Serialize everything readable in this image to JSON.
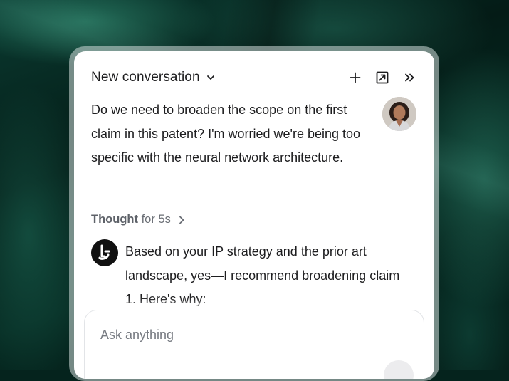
{
  "header": {
    "title": "New conversation",
    "icons": [
      "chevron-down-icon",
      "plus-icon",
      "open-external-icon",
      "double-chevron-right-icon"
    ]
  },
  "conversation": {
    "user_message": "Do we need to broaden the scope on the first claim in this patent? I'm worried we're being too specific with the neural network architecture.",
    "thought": {
      "label": "Thought",
      "duration": "for 5s"
    },
    "assistant_message": "Based on your IP strategy and the prior art landscape, yes—I recommend broadening claim 1. Here's why:"
  },
  "composer": {
    "placeholder": "Ask anything"
  },
  "colors": {
    "background": "#05231d",
    "panel": "#ffffff",
    "text": "#1d1d1f",
    "muted": "#6b6f76"
  }
}
